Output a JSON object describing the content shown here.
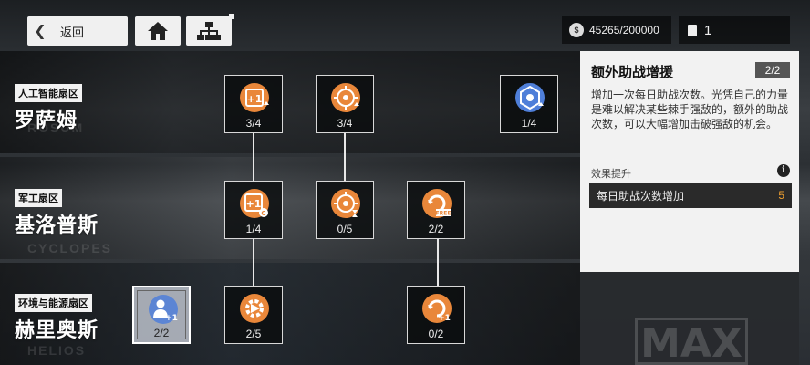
{
  "header": {
    "back_label": "返回",
    "currency_value": "45265/200000",
    "ticket_value": "1"
  },
  "districts": [
    {
      "tag": "人工智能扇区",
      "name": "罗萨姆",
      "watermark": "ROSUM"
    },
    {
      "tag": "军工扇区",
      "name": "基洛普斯",
      "watermark": "CYCLOPES"
    },
    {
      "tag": "环境与能源扇区",
      "name": "赫里奥斯",
      "watermark": "HELIOS"
    }
  ],
  "nodes": {
    "r1c1": {
      "count": "3/4",
      "icon": "plus-one-up-icon"
    },
    "r1c2": {
      "count": "3/4",
      "icon": "target-up-icon"
    },
    "r1c4": {
      "count": "1/4",
      "icon": "hexagon-up-icon"
    },
    "r2c1": {
      "count": "1/4",
      "icon": "plus-one-coin-icon"
    },
    "r2c2": {
      "count": "0/5",
      "icon": "target-hourglass-icon"
    },
    "r2c3": {
      "count": "2/2",
      "icon": "free-refresh-icon"
    },
    "r3c0": {
      "count": "2/2",
      "icon": "person-plus-one-icon"
    },
    "r3c1": {
      "count": "2/5",
      "icon": "gear-refresh-icon"
    },
    "r3c3": {
      "count": "0/2",
      "icon": "refresh-plus-one-icon"
    }
  },
  "panel": {
    "title": "额外助战增援",
    "level": "2/2",
    "description": "增加一次每日助战次数。光凭自己的力量是难以解决某些棘手强敌的，额外的助战次数，可以大幅增加击破强敌的机会。",
    "effect_label": "效果提升",
    "effect_name": "每日助战次数增加",
    "effect_value": "5",
    "max_label": "MAX"
  },
  "colors": {
    "accent_orange": "#e9873a",
    "accent_blue": "#4f7fd9",
    "panel_bg": "#f2f2f2"
  }
}
